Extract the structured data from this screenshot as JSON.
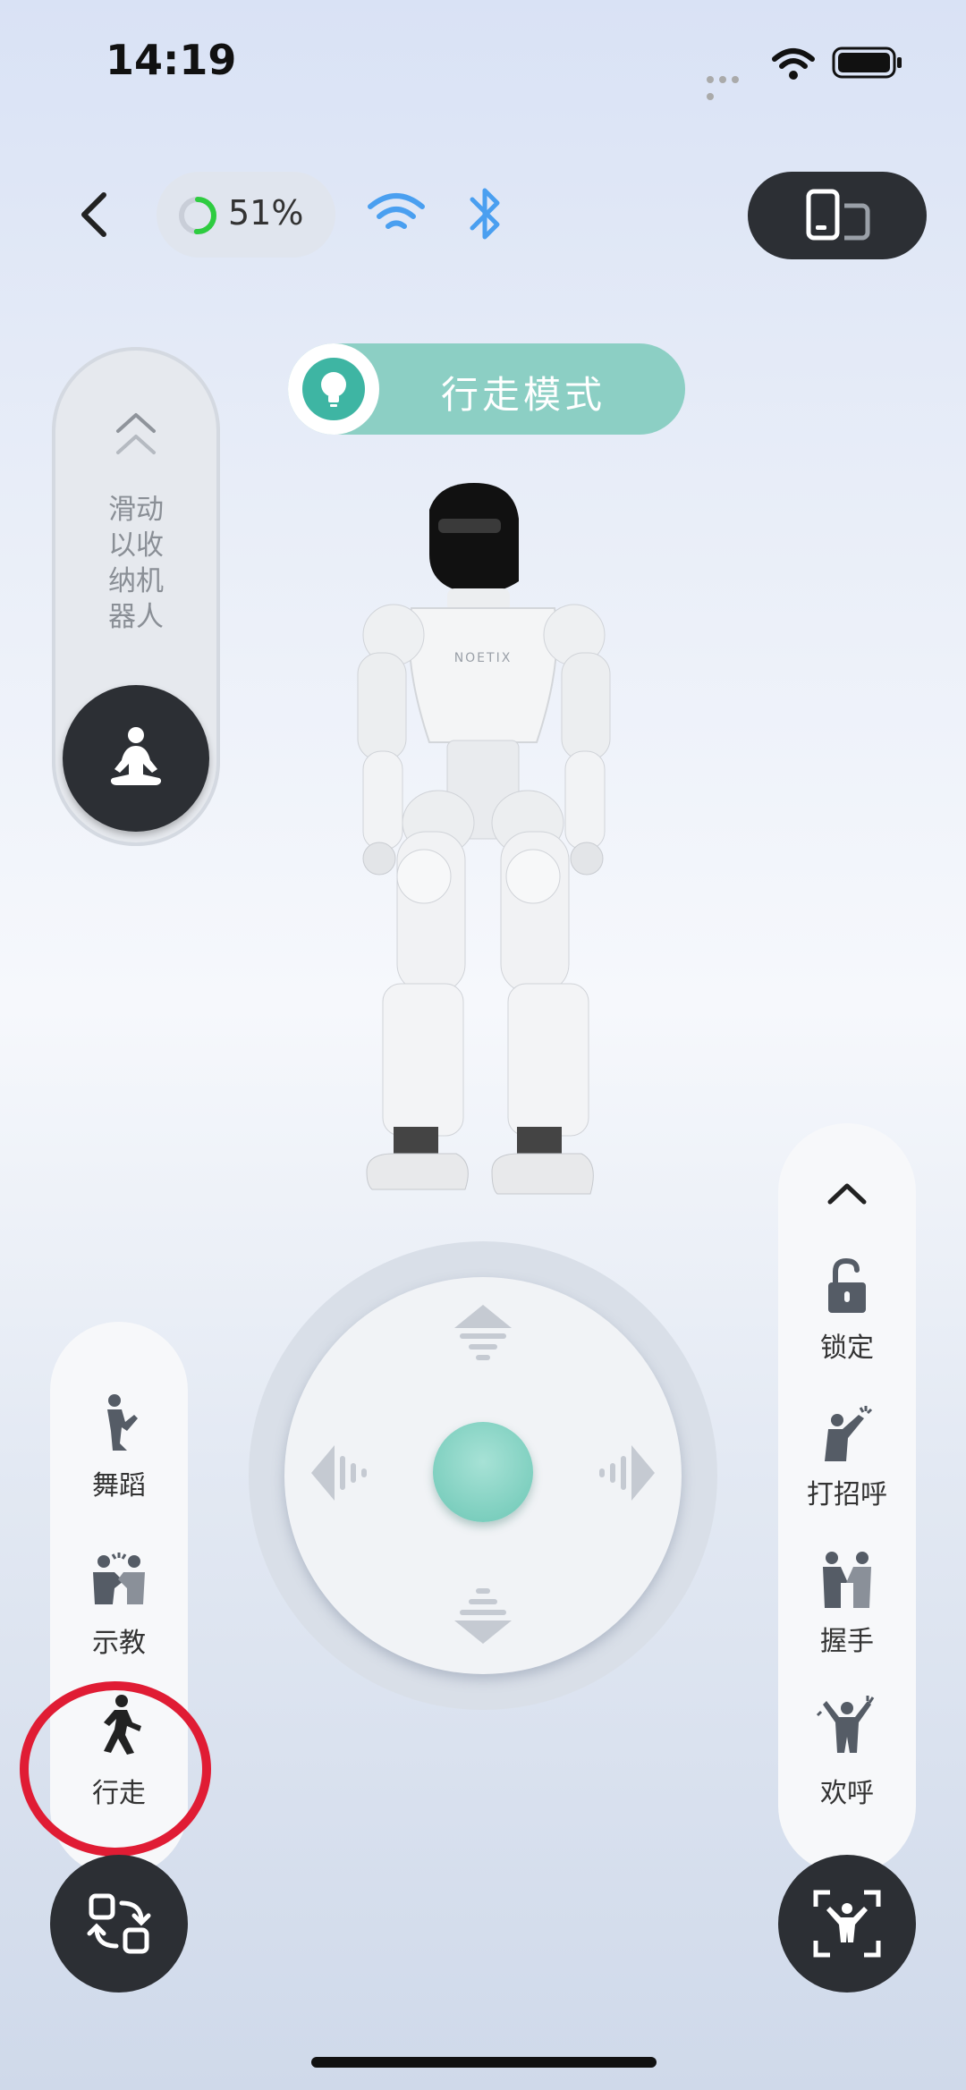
{
  "status_bar": {
    "time": "14:19"
  },
  "top_bar": {
    "battery_percent": "51%",
    "battery_level": 0.51
  },
  "mode": {
    "label": "行走模式"
  },
  "slide_panel": {
    "hint_lines": [
      "滑动",
      "以收",
      "纳机",
      "器人"
    ]
  },
  "left_actions": [
    {
      "label": "舞蹈",
      "icon": "dance-icon"
    },
    {
      "label": "示教",
      "icon": "teach-icon"
    },
    {
      "label": "行走",
      "icon": "walk-icon"
    }
  ],
  "right_actions": [
    {
      "label": "锁定",
      "icon": "lock-icon"
    },
    {
      "label": "打招呼",
      "icon": "wave-icon"
    },
    {
      "label": "握手",
      "icon": "handshake-icon"
    },
    {
      "label": "欢呼",
      "icon": "cheer-icon"
    }
  ],
  "robot": {
    "brand": "NOETIX"
  },
  "colors": {
    "accent": "#8ccfc4",
    "accent_dark": "#3eb5a3",
    "dark_button": "#2c2f34",
    "highlight": "#e01c34"
  }
}
